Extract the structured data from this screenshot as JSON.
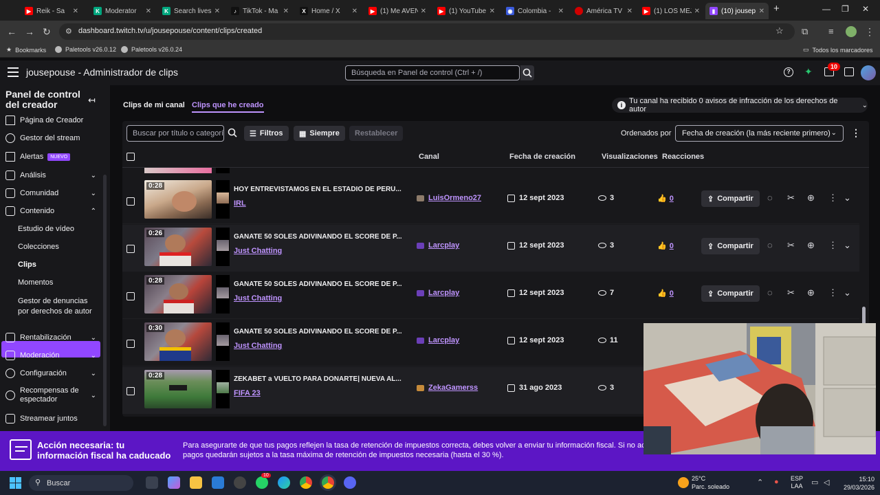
{
  "browser": {
    "tabs": [
      {
        "label": "Reik - Sa",
        "color": "#ff0000",
        "icon": "youtube-icon"
      },
      {
        "label": "Moderator",
        "color": "#00a67e",
        "icon": "kick-icon"
      },
      {
        "label": "Search lives",
        "color": "#00a67e",
        "icon": "kick-icon"
      },
      {
        "label": "TikTok - Ma",
        "color": "#111111",
        "icon": "tiktok-icon"
      },
      {
        "label": "Home / X",
        "color": "#111111",
        "icon": "x-icon"
      },
      {
        "label": "(1) Me AVEN",
        "color": "#ff0000",
        "icon": "youtube-icon"
      },
      {
        "label": "(1) YouTube",
        "color": "#ff0000",
        "icon": "youtube-icon"
      },
      {
        "label": "Colombia - ",
        "color": "#3b5bdb",
        "icon": "globe-icon"
      },
      {
        "label": "América TV",
        "color": "#d10000",
        "icon": "america-tv-icon"
      },
      {
        "label": "(1) LOS MEJ",
        "color": "#ff0000",
        "icon": "youtube-icon"
      },
      {
        "label": "(10) jousep",
        "color": "#9147ff",
        "icon": "twitch-icon"
      }
    ],
    "url": "dashboard.twitch.tv/u/jousepouse/content/clips/created",
    "bookmarks": {
      "label": "Bookmarks",
      "items": [
        "Paletools v26.0.12",
        "Paletools v26.0.24"
      ],
      "all": "Todos los marcadores"
    }
  },
  "topnav": {
    "title": "jousepouse - Administrador de clips",
    "search_placeholder": "Búsqueda en Panel de control (Ctrl + /)",
    "notif_count": "10"
  },
  "sidebar": {
    "title": "Panel de control del creador",
    "items": [
      {
        "label": "Página de Creador"
      },
      {
        "label": "Gestor del stream"
      },
      {
        "label": "Alertas",
        "badge": "NUEVO"
      },
      {
        "label": "Análisis"
      },
      {
        "label": "Comunidad"
      },
      {
        "label": "Contenido"
      }
    ],
    "subitems": [
      "Estudio de vídeo",
      "Colecciones",
      "Clips",
      "Momentos",
      "Gestor de denuncias por derechos de autor"
    ],
    "items_bottom": [
      {
        "label": "Rentabilización"
      },
      {
        "label": "Moderación"
      },
      {
        "label": "Configuración"
      },
      {
        "label": "Recompensas de espectador"
      },
      {
        "label": "Streamear juntos"
      }
    ]
  },
  "content": {
    "tab_channel": "Clips de mi canal",
    "tab_created": "Clips que he creado",
    "copyright_notice": "Tu canal ha recibido 0 avisos de infracción de los derechos de autor",
    "filter_placeholder": "Buscar por título o categoría",
    "btn_filters": "Filtros",
    "btn_range": "Siempre",
    "btn_reset": "Restablecer",
    "sort_label": "Ordenados por",
    "sort_value": "Fecha de creación (la más reciente primero)",
    "headers": {
      "channel": "Canal",
      "date": "Fecha de creación",
      "views": "Visualizaciones",
      "reactions": "Reacciones"
    },
    "share_label": "Compartir",
    "clips": [
      {
        "duration": "0:28",
        "title": "HOY ENTREVISTAMOS EN EL ESTADIO DE PERÚ...",
        "category": "IRL",
        "channel": "LuisOrmeno27",
        "date": "12 sept 2023",
        "views": "3",
        "reactions": "0"
      },
      {
        "duration": "0:26",
        "title": "GANATE 50 SOLES ADIVINANDO EL SCORE DE P...",
        "category": "Just Chatting",
        "channel": "Larcplay",
        "date": "12 sept 2023",
        "views": "3",
        "reactions": "0"
      },
      {
        "duration": "0:28",
        "title": "GANATE 50 SOLES ADIVINANDO EL SCORE DE P...",
        "category": "Just Chatting",
        "channel": "Larcplay",
        "date": "12 sept 2023",
        "views": "7",
        "reactions": "0"
      },
      {
        "duration": "0:30",
        "title": "GANATE 50 SOLES ADIVINANDO EL SCORE DE P...",
        "category": "Just Chatting",
        "channel": "Larcplay",
        "date": "12 sept 2023",
        "views": "11",
        "reactions": ""
      },
      {
        "duration": "0:28",
        "title": "ZEKABET a VUELTO PARA DONARTE| NUEVA AL...",
        "category": "FIFA 23",
        "channel": "ZekaGamerss",
        "date": "31 ago 2023",
        "views": "3",
        "reactions": ""
      }
    ]
  },
  "taxbar": {
    "title": "Acción necesaria: tu información fiscal ha caducado",
    "line1": "Para asegurarte de que tus pagos reflejen la tasa de retención de impuestos correcta, debes volver a enviar tu información fiscal. Si no actu",
    "line2": "pagos quedarán sujetos a la tasa máxima de retención de impuestos necesaria (hasta el 30 %)."
  },
  "taskbar": {
    "search": "Buscar",
    "weather_temp": "25°C",
    "weather_desc": "Parc. soleado",
    "lang1": "ESP",
    "lang2": "LAA",
    "time": "15:10",
    "date": "29/03/2026",
    "badge_whatsapp": "10"
  }
}
